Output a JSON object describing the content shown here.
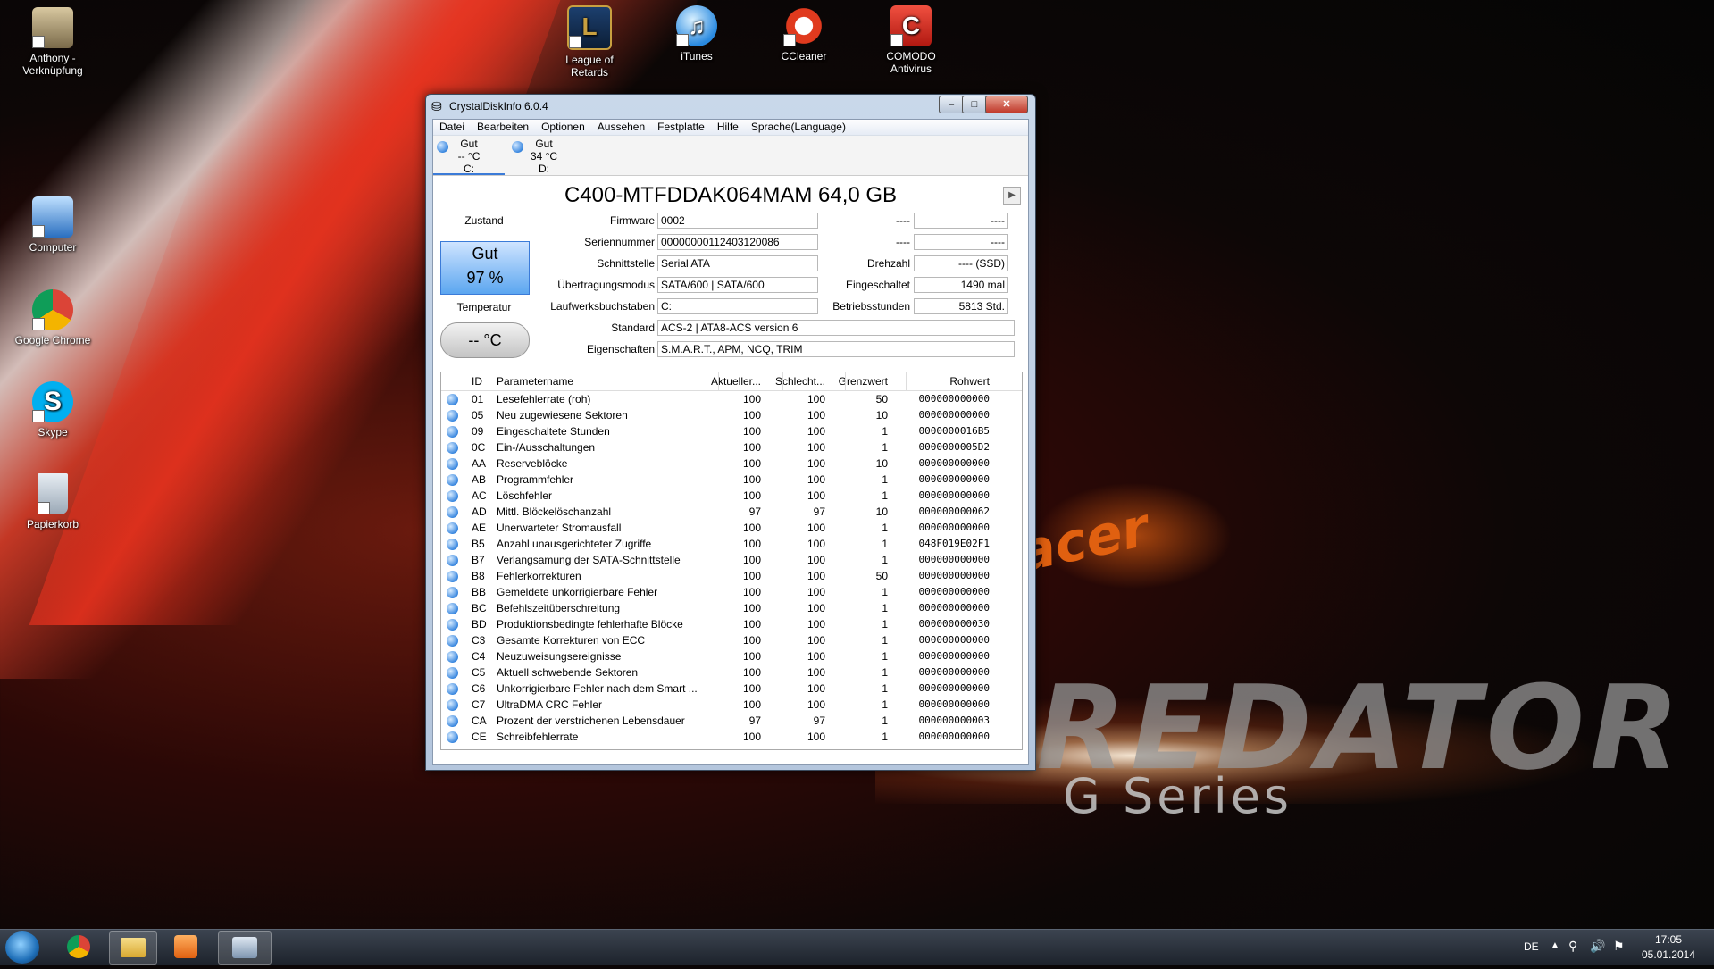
{
  "desktop": {
    "left_icons": [
      {
        "label": "Anthony - Verknüpfung"
      },
      {
        "label": "Computer"
      },
      {
        "label": "Google Chrome"
      },
      {
        "label": "Skype"
      },
      {
        "label": "Papierkorb"
      }
    ],
    "top_icons": [
      {
        "label": "League of Retards"
      },
      {
        "label": "iTunes"
      },
      {
        "label": "CCleaner"
      },
      {
        "label": "COMODO Antivirus"
      }
    ],
    "wallpaper": {
      "brand": "acer",
      "title": "REDATOR",
      "subtitle": "G Series"
    }
  },
  "window": {
    "title": "CrystalDiskInfo 6.0.4",
    "controls": {
      "minimize": "–",
      "maximize": "□",
      "close": "✕"
    },
    "menu": [
      "Datei",
      "Bearbeiten",
      "Optionen",
      "Aussehen",
      "Festplatte",
      "Hilfe",
      "Sprache(Language)"
    ],
    "drives": [
      {
        "status": "Gut",
        "temp": "-- °C",
        "letter": "C:"
      },
      {
        "status": "Gut",
        "temp": "34 °C",
        "letter": "D:"
      }
    ],
    "model": "C400-MTFDDAK064MAM 64,0 GB",
    "next_arrow": "▶",
    "zustand_label": "Zustand",
    "health_status": "Gut",
    "health_percent": "97 %",
    "temperatur_label": "Temperatur",
    "temperature": "-- °C",
    "fields": {
      "firmware_label": "Firmware",
      "firmware": "0002",
      "serial_label": "Seriennummer",
      "serial": "00000000112403120086",
      "interface_label": "Schnittstelle",
      "interface": "Serial ATA",
      "transfer_label": "Übertragungsmodus",
      "transfer": "SATA/600 | SATA/600",
      "letters_label": "Laufwerksbuchstaben",
      "letters": "C:",
      "standard_label": "Standard",
      "standard": "ACS-2 | ATA8-ACS version 6",
      "features_label": "Eigenschaften",
      "features": "S.M.A.R.T., APM, NCQ, TRIM",
      "blank1_label": "----",
      "blank1": "----",
      "blank2_label": "----",
      "blank2": "----",
      "rpm_label": "Drehzahl",
      "rpm": "---- (SSD)",
      "power_count_label": "Eingeschaltet",
      "power_count": "1490 mal",
      "hours_label": "Betriebsstunden",
      "hours": "5813 Std."
    },
    "table": {
      "headers": {
        "id": "ID",
        "name": "Parametername",
        "current": "Aktueller...",
        "worst": "Schlecht...",
        "threshold": "Grenzwert",
        "raw": "Rohwert"
      },
      "rows": [
        {
          "id": "01",
          "name": "Lesefehlerrate (roh)",
          "current": "100",
          "worst": "100",
          "threshold": "50",
          "raw": "000000000000"
        },
        {
          "id": "05",
          "name": "Neu zugewiesene Sektoren",
          "current": "100",
          "worst": "100",
          "threshold": "10",
          "raw": "000000000000"
        },
        {
          "id": "09",
          "name": "Eingeschaltete Stunden",
          "current": "100",
          "worst": "100",
          "threshold": "1",
          "raw": "0000000016B5"
        },
        {
          "id": "0C",
          "name": "Ein-/Ausschaltungen",
          "current": "100",
          "worst": "100",
          "threshold": "1",
          "raw": "0000000005D2"
        },
        {
          "id": "AA",
          "name": "Reserveblöcke",
          "current": "100",
          "worst": "100",
          "threshold": "10",
          "raw": "000000000000"
        },
        {
          "id": "AB",
          "name": "Programmfehler",
          "current": "100",
          "worst": "100",
          "threshold": "1",
          "raw": "000000000000"
        },
        {
          "id": "AC",
          "name": "Löschfehler",
          "current": "100",
          "worst": "100",
          "threshold": "1",
          "raw": "000000000000"
        },
        {
          "id": "AD",
          "name": "Mittl. Blöckelöschanzahl",
          "current": "97",
          "worst": "97",
          "threshold": "10",
          "raw": "000000000062"
        },
        {
          "id": "AE",
          "name": "Unerwarteter Stromausfall",
          "current": "100",
          "worst": "100",
          "threshold": "1",
          "raw": "000000000000"
        },
        {
          "id": "B5",
          "name": "Anzahl unausgerichteter Zugriffe",
          "current": "100",
          "worst": "100",
          "threshold": "1",
          "raw": "048F019E02F1"
        },
        {
          "id": "B7",
          "name": "Verlangsamung der SATA-Schnittstelle",
          "current": "100",
          "worst": "100",
          "threshold": "1",
          "raw": "000000000000"
        },
        {
          "id": "B8",
          "name": "Fehlerkorrekturen",
          "current": "100",
          "worst": "100",
          "threshold": "50",
          "raw": "000000000000"
        },
        {
          "id": "BB",
          "name": "Gemeldete unkorrigierbare Fehler",
          "current": "100",
          "worst": "100",
          "threshold": "1",
          "raw": "000000000000"
        },
        {
          "id": "BC",
          "name": "Befehlszeitüberschreitung",
          "current": "100",
          "worst": "100",
          "threshold": "1",
          "raw": "000000000000"
        },
        {
          "id": "BD",
          "name": "Produktionsbedingte fehlerhafte Blöcke",
          "current": "100",
          "worst": "100",
          "threshold": "1",
          "raw": "000000000030"
        },
        {
          "id": "C3",
          "name": "Gesamte Korrekturen von ECC",
          "current": "100",
          "worst": "100",
          "threshold": "1",
          "raw": "000000000000"
        },
        {
          "id": "C4",
          "name": "Neuzuweisungsereignisse",
          "current": "100",
          "worst": "100",
          "threshold": "1",
          "raw": "000000000000"
        },
        {
          "id": "C5",
          "name": "Aktuell schwebende Sektoren",
          "current": "100",
          "worst": "100",
          "threshold": "1",
          "raw": "000000000000"
        },
        {
          "id": "C6",
          "name": "Unkorrigierbare Fehler nach dem Smart ...",
          "current": "100",
          "worst": "100",
          "threshold": "1",
          "raw": "000000000000"
        },
        {
          "id": "C7",
          "name": "UltraDMA CRC Fehler",
          "current": "100",
          "worst": "100",
          "threshold": "1",
          "raw": "000000000000"
        },
        {
          "id": "CA",
          "name": "Prozent der verstrichenen Lebensdauer",
          "current": "97",
          "worst": "97",
          "threshold": "1",
          "raw": "000000000003"
        },
        {
          "id": "CE",
          "name": "Schreibfehlerrate",
          "current": "100",
          "worst": "100",
          "threshold": "1",
          "raw": "000000000000"
        }
      ]
    }
  },
  "taskbar": {
    "language": "DE",
    "time": "17:05",
    "date": "05.01.2014"
  },
  "colors": {
    "health_blue": "#5ba6f0",
    "status_dot": "#3a88e0"
  }
}
